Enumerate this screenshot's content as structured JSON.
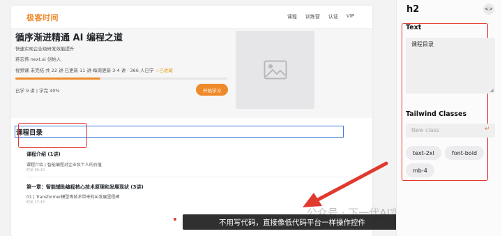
{
  "site": {
    "logo": "极客时间",
    "nav": [
      "课程",
      "训练营",
      "认证",
      "VIP"
    ]
  },
  "course": {
    "title": "循序渐进精通 AI 编程之道",
    "subtitle": "快速实现企业级研发效能提升",
    "author": "蒋志伟 next.ai 创始人",
    "meta": "视频课 未完结·共 22 讲·已更新 11 讲·每周更新 3-4 讲 · 366 人已学",
    "fav": "☆已收藏",
    "progress_fraction": 0.4,
    "stats": "已学 9 讲 | 学完 40%",
    "start_button": "开始学习"
  },
  "catalog": {
    "heading": "课程目录",
    "intro_title": "课程介绍 (1讲)",
    "intro_lesson": "课程介绍 | 智能编程对企业及个人的价值",
    "intro_duration": "时长 06:10",
    "ch1_title": "第一章：智能辅助编程核心技术原理和发展现状 (3讲)",
    "ch1_lesson": "01 | Transformer模型等技术带来的AI发展里程碑",
    "ch1_duration": "时长 17:43"
  },
  "overlay": {
    "caption": "不用写代码，直接像低代码平台一样操作控件",
    "watermark": "公众号 · 下一代AI实验室"
  },
  "panel": {
    "tag": "h2",
    "code_icon": "<>",
    "text_label": "Text",
    "text_value": "课程目录",
    "classes_label": "Tailwind Classes",
    "new_class_placeholder": "New class",
    "classes": [
      "text-2xl",
      "font-bold",
      "mb-4"
    ]
  },
  "colors": {
    "accent": "#ef8a2a",
    "highlight": "#e03a2f",
    "selection": "#3a76d8"
  }
}
